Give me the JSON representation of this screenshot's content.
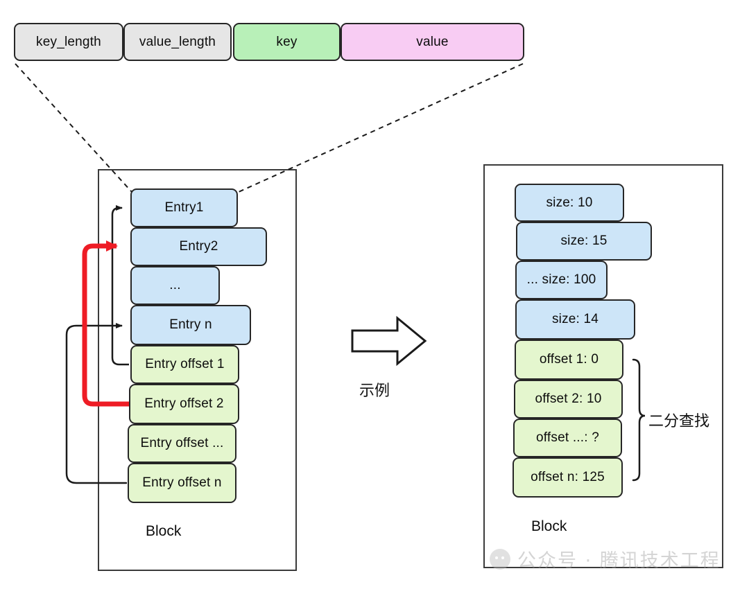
{
  "diagram": {
    "title_record_bar": {
      "fields": [
        {
          "label": "key_length",
          "color": "#e6e6e6"
        },
        {
          "label": "value_length",
          "color": "#e6e6e6"
        },
        {
          "label": "key",
          "color": "#b8f0b8"
        },
        {
          "label": "value",
          "color": "#f8ccf3"
        }
      ]
    },
    "left_block": {
      "block_label": "Block",
      "entries": [
        {
          "label": "Entry1",
          "color": "#cde5f8"
        },
        {
          "label": "Entry2",
          "color": "#cde5f8"
        },
        {
          "label": "...",
          "color": "#cde5f8"
        },
        {
          "label": "Entry n",
          "color": "#cde5f8"
        }
      ],
      "offsets": [
        {
          "label": "Entry offset 1",
          "color": "#e4f6ce"
        },
        {
          "label": "Entry offset 2",
          "color": "#e4f6ce"
        },
        {
          "label": "Entry offset ...",
          "color": "#e4f6ce"
        },
        {
          "label": "Entry offset n",
          "color": "#e4f6ce"
        }
      ]
    },
    "middle": {
      "arrow_label": "示例"
    },
    "right_block": {
      "block_label": "Block",
      "entries": [
        {
          "label": "size: 10",
          "color": "#cde5f8"
        },
        {
          "label": "size: 15",
          "color": "#cde5f8"
        },
        {
          "label": "... size: 100",
          "color": "#cde5f8"
        },
        {
          "label": "size: 14",
          "color": "#cde5f8"
        }
      ],
      "offsets": [
        {
          "label": "offset 1: 0",
          "color": "#e4f6ce"
        },
        {
          "label": "offset 2: 10",
          "color": "#e4f6ce"
        },
        {
          "label": "offset ...: ?",
          "color": "#e4f6ce"
        },
        {
          "label": "offset n: 125",
          "color": "#e4f6ce"
        }
      ],
      "brace_label": "二分查找"
    },
    "watermark": {
      "text": "公众号 · 腾讯技术工程"
    },
    "colors": {
      "highlight_arrow": "#ee1c25",
      "pointer_arrow": "#1a1a1a",
      "frame_stroke": "#3a3a3a",
      "dashed_stroke": "#1a1a1a"
    }
  }
}
